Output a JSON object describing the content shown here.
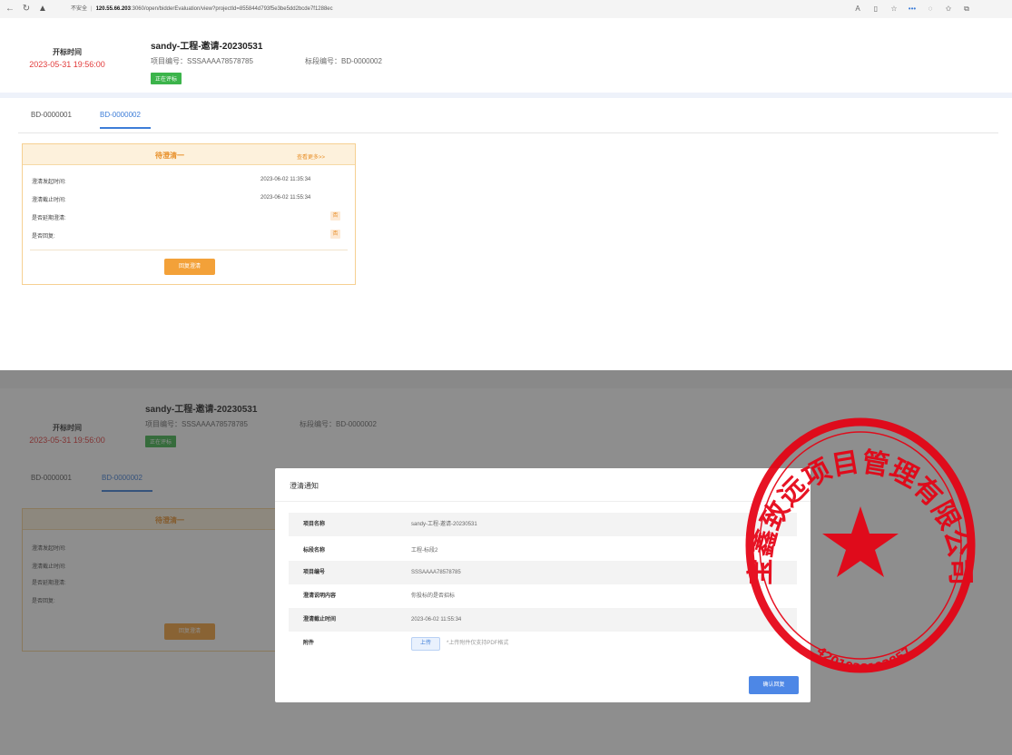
{
  "browser": {
    "security": "不安全",
    "host": "120.55.66.203",
    "path": ":3060/open/bidderEvaluation/view?projectId=855844d793f5e3be5dd2bcde7f1288ec"
  },
  "header": {
    "label": "开标时间",
    "time": "2023-05-31 19:56:00",
    "project_name": "sandy-工程-邀请-20230531",
    "project_no": "项目编号：SSSAAAA78578785",
    "section_no": "标段编号：BD-0000002",
    "badge": "正在评标"
  },
  "tabs": [
    {
      "label": "BD-0000001"
    },
    {
      "label": "BD-0000002"
    }
  ],
  "clarify_card": {
    "title": "待澄清一",
    "more": "查看更多>>",
    "rows": [
      {
        "label": "澄清发起时间:",
        "value": "2023-06-02 11:35:34"
      },
      {
        "label": "澄清截止时间:",
        "value": "2023-06-02 11:55:34"
      },
      {
        "label": "是否延期澄清:",
        "value": "否"
      },
      {
        "label": "是否回复:",
        "value": "否"
      }
    ],
    "reply_button": "回复澄清"
  },
  "modal": {
    "title": "澄清通知",
    "rows": [
      {
        "label": "项目名称",
        "value": "sandy-工程-邀请-20230531"
      },
      {
        "label": "标段名称",
        "value": "工程-标段2"
      },
      {
        "label": "项目编号",
        "value": "SSSAAAA78578785"
      },
      {
        "label": "澄清说明内容",
        "value": "你投标的是否招标"
      },
      {
        "label": "澄清截止时间",
        "value": "2023-06-02 11:55:34"
      },
      {
        "label": "附件",
        "value": ""
      }
    ],
    "upload_button": "上传",
    "upload_hint": "*上传附件仅支持PDF格式",
    "confirm_button": "确认回复"
  },
  "seal": {
    "ring_text": "宝鑫致远项目管理有限公司",
    "number": "4201028193857",
    "color": "#e60012"
  },
  "colors": {
    "accent": "#3d7dd8",
    "deadline_red": "#e23b3b",
    "orange": "#f3a139",
    "status_green": "#3cb44b"
  }
}
